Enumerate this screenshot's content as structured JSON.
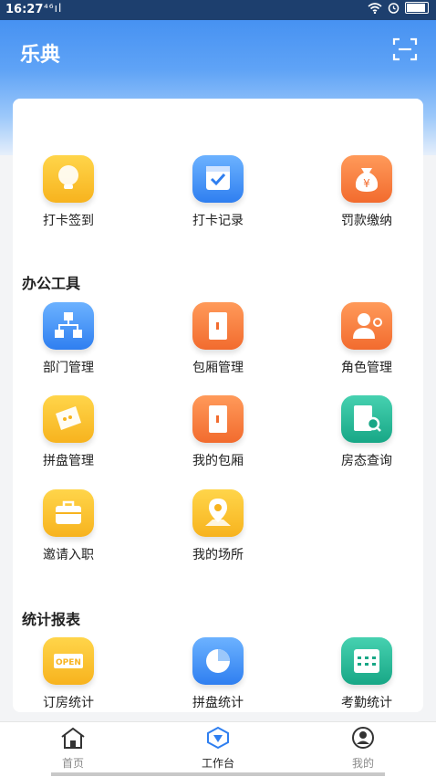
{
  "status_bar": {
    "time": "16:27",
    "network": "⁴⁶ıl"
  },
  "header": {
    "title": "乐典"
  },
  "quick_actions": [
    {
      "label": "打卡签到",
      "icon": "lightbulb-icon"
    },
    {
      "label": "打卡记录",
      "icon": "calendar-check-icon"
    },
    {
      "label": "罚款缴纳",
      "icon": "money-bag-icon"
    }
  ],
  "sections": [
    {
      "title": "办公工具",
      "items": [
        {
          "label": "部门管理",
          "icon": "org-chart-icon"
        },
        {
          "label": "包厢管理",
          "icon": "door-icon"
        },
        {
          "label": "角色管理",
          "icon": "user-gear-icon"
        },
        {
          "label": "拼盘管理",
          "icon": "ticket-icon"
        },
        {
          "label": "我的包厢",
          "icon": "door-icon"
        },
        {
          "label": "房态查询",
          "icon": "room-search-icon"
        },
        {
          "label": "邀请入职",
          "icon": "briefcase-icon"
        },
        {
          "label": "我的场所",
          "icon": "location-pin-icon"
        }
      ]
    },
    {
      "title": "统计报表",
      "items": [
        {
          "label": "订房统计",
          "icon": "open-sign-icon",
          "sign_text": "OPEN"
        },
        {
          "label": "拼盘统计",
          "icon": "pie-chart-icon"
        },
        {
          "label": "考勤统计",
          "icon": "calendar-grid-icon"
        }
      ]
    }
  ],
  "tabbar": {
    "tabs": [
      {
        "label": "首页",
        "icon": "home-icon"
      },
      {
        "label": "工作台",
        "icon": "workbench-icon",
        "active": true
      },
      {
        "label": "我的",
        "icon": "profile-icon"
      }
    ]
  },
  "colors": {
    "accent": "#2f7ff0",
    "header_top": "#3d8bf0",
    "inactive_tab": "#8a8a8a"
  }
}
